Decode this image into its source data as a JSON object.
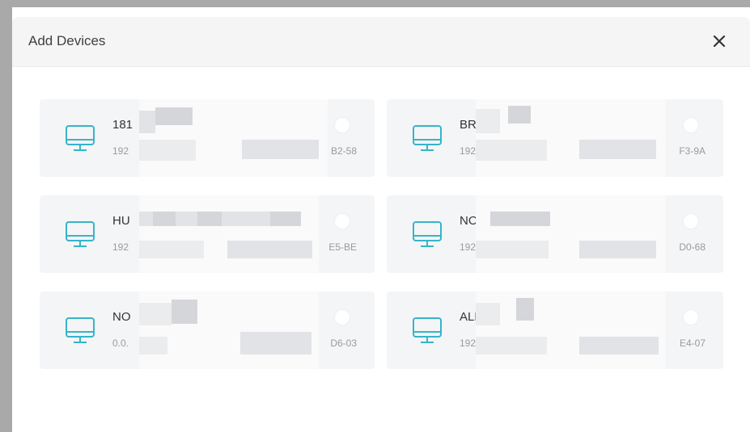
{
  "dialog": {
    "title": "Add Devices",
    "close_label": "✕"
  },
  "devices": [
    {
      "name": "181",
      "ip": "192",
      "mac": "B2-58"
    },
    {
      "name": "BR/",
      "ip": "192",
      "mac": "F3-9A"
    },
    {
      "name": "HU",
      "ip": "192",
      "mac": "E5-BE"
    },
    {
      "name": "NOI",
      "ip": "192",
      "mac": "D0-68"
    },
    {
      "name": "NO",
      "ip": "0.0.",
      "mac": "D6-03"
    },
    {
      "name": "ALN",
      "ip": "192",
      "mac": "E4-07"
    }
  ],
  "colors": {
    "accent": "#35b5c9",
    "card_bg": "#f4f5f7",
    "header_bg": "#f5f5f6"
  }
}
